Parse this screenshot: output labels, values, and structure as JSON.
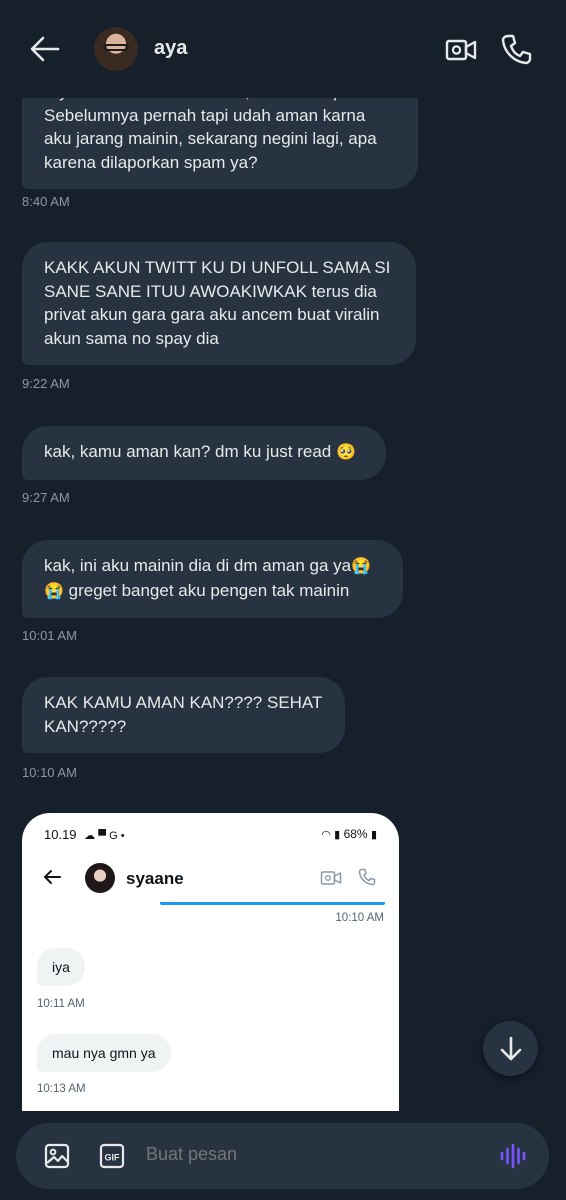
{
  "header": {
    "contact_name": "aya",
    "icons": {
      "back": "back-arrow-icon",
      "video": "video-call-icon",
      "call": "phone-call-icon"
    }
  },
  "messages": [
    {
      "text": "Siyal wa ke ke banned kak, ini karna apa sih? Sebelumnya pernah tapi udah aman karna aku jarang mainin, sekarang negini lagi, apa karena dilaporkan spam ya?",
      "time": "8:40 AM"
    },
    {
      "text": "KAKK AKUN TWITT KU DI UNFOLL SAMA SI SANE SANE ITUU AWOAKIWKAK terus dia privat akun gara gara aku ancem buat viralin akun sama no spay dia",
      "time": "9:22 AM"
    },
    {
      "text": "kak, kamu aman kan? dm ku just read",
      "emoji": "🥺",
      "time": "9:27 AM"
    },
    {
      "text_a": "kak, ini aku mainin dia di dm aman ga ya",
      "emoji_a": "😭",
      "emoji_b": "😭",
      "text_b": " greget banget aku pengen tak mainin",
      "time": "10:01 AM"
    },
    {
      "text": "KAK KAMU AMAN KAN???? SEHAT KAN?????",
      "time": "10:10 AM"
    }
  ],
  "screenshot": {
    "status_time": "10.19",
    "status_icons": "☁ ▀ G •",
    "battery": "68%",
    "contact_name": "syaane",
    "sent_time": "10:10 AM",
    "messages": [
      {
        "text": "iya",
        "time": "10:11 AM"
      },
      {
        "text": "mau nya gmn ya",
        "time": "10:13 AM"
      }
    ]
  },
  "composer": {
    "placeholder": "Buat pesan",
    "icons": {
      "image": "image-icon",
      "gif": "gif-icon",
      "voice": "voice-message-icon"
    }
  },
  "colors": {
    "background": "#15202b",
    "bubble": "#273340",
    "accent": "#1d9bf0",
    "voice_accent": "#7856ff"
  }
}
